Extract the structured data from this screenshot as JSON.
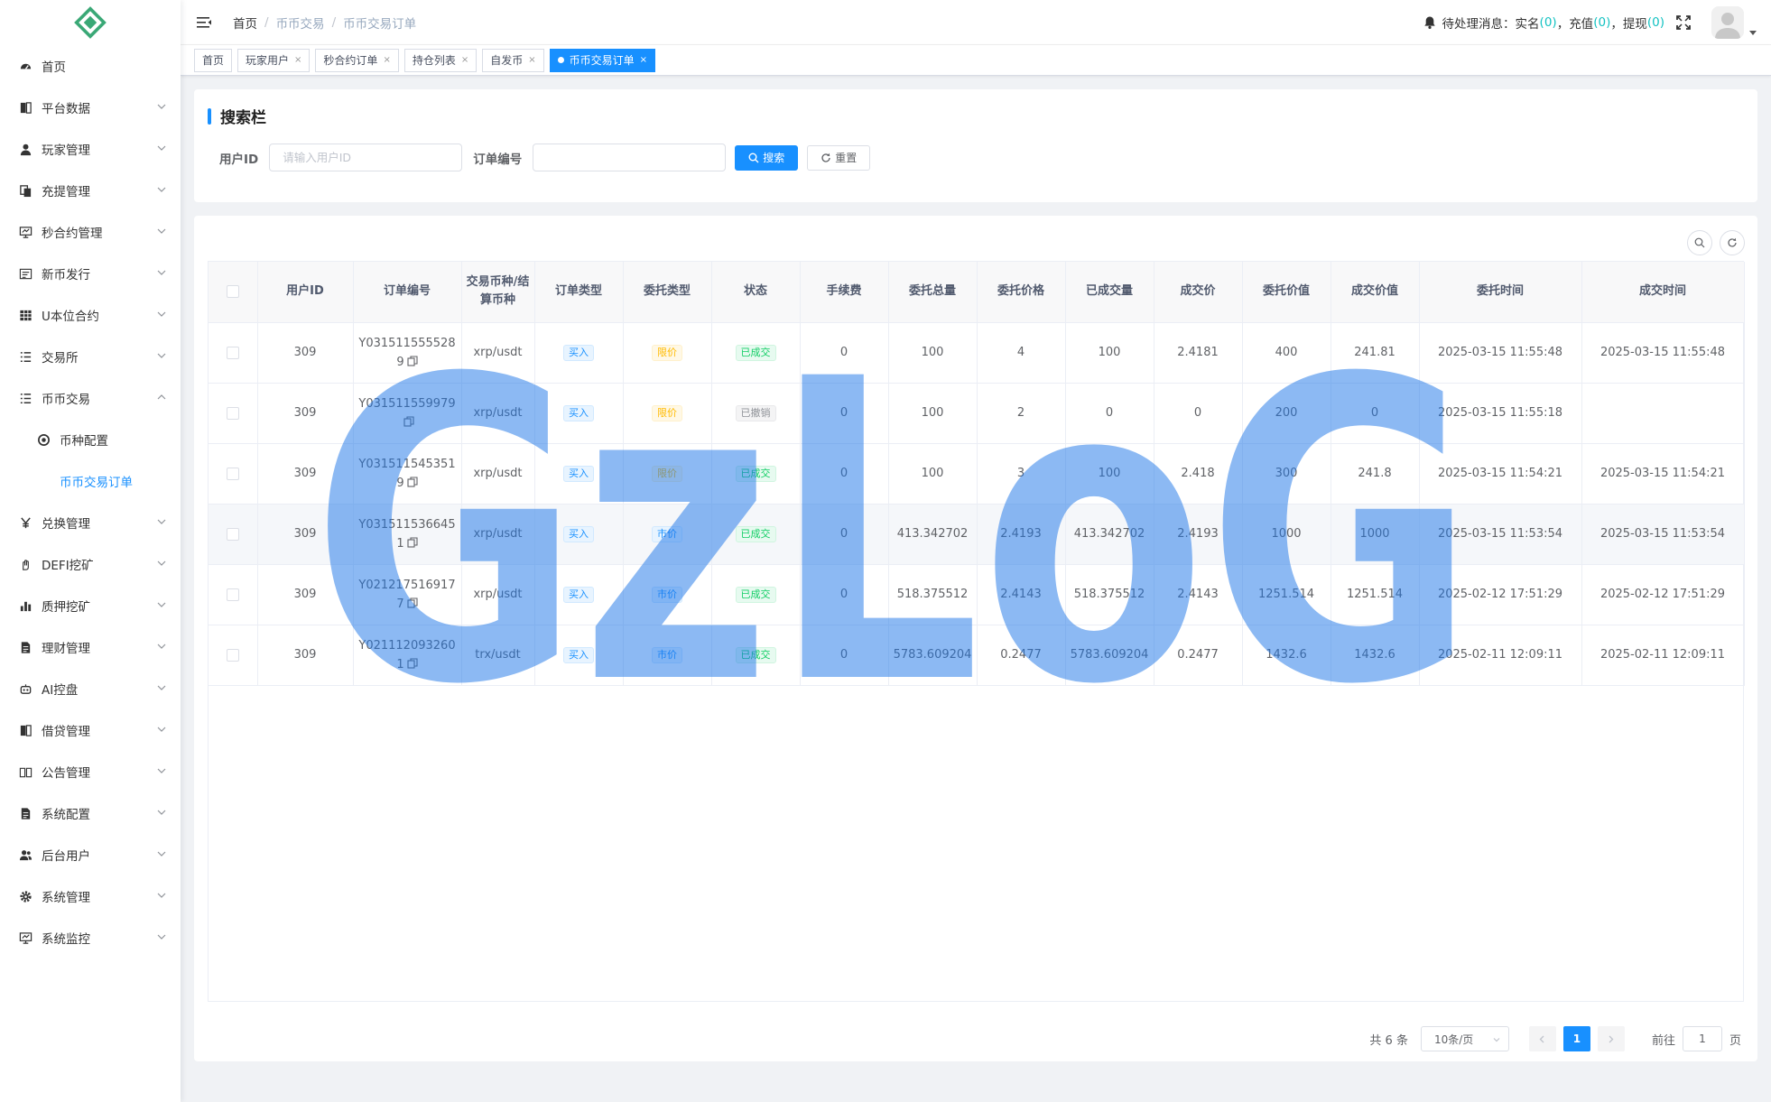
{
  "sidebar": {
    "items": [
      {
        "label": "首页",
        "icon": "dashboard-icon",
        "expandable": false
      },
      {
        "label": "平台数据",
        "icon": "book-icon",
        "expandable": true
      },
      {
        "label": "玩家管理",
        "icon": "user-icon",
        "expandable": true
      },
      {
        "label": "充提管理",
        "icon": "copy-icon",
        "expandable": true
      },
      {
        "label": "秒合约管理",
        "icon": "monitor-chart-icon",
        "expandable": true
      },
      {
        "label": "新币发行",
        "icon": "form-icon",
        "expandable": true
      },
      {
        "label": "U本位合约",
        "icon": "table-icon",
        "expandable": true
      },
      {
        "label": "交易所",
        "icon": "list-icon",
        "expandable": true
      },
      {
        "label": "币币交易",
        "icon": "list-icon",
        "expandable": true,
        "expanded": true
      },
      {
        "label": "币种配置",
        "icon": "coin-icon",
        "sub": true
      },
      {
        "label": "币币交易订单",
        "sub": true,
        "active": true
      },
      {
        "label": "兑换管理",
        "icon": "yen-icon",
        "expandable": true
      },
      {
        "label": "DEFI挖矿",
        "icon": "hand-icon",
        "expandable": true
      },
      {
        "label": "质押挖矿",
        "icon": "bar-chart-icon",
        "expandable": true
      },
      {
        "label": "理财管理",
        "icon": "document-icon",
        "expandable": true
      },
      {
        "label": "AI控盘",
        "icon": "robot-icon",
        "expandable": true
      },
      {
        "label": "借贷管理",
        "icon": "book-icon",
        "expandable": true
      },
      {
        "label": "公告管理",
        "icon": "open-book-icon",
        "expandable": true
      },
      {
        "label": "系统配置",
        "icon": "document-icon",
        "expandable": true
      },
      {
        "label": "后台用户",
        "icon": "users-icon",
        "expandable": true
      },
      {
        "label": "系统管理",
        "icon": "gear-icon",
        "expandable": true
      },
      {
        "label": "系统监控",
        "icon": "monitor-chart-icon",
        "expandable": true
      }
    ]
  },
  "header": {
    "breadcrumb": [
      "首页",
      "币币交易",
      "币币交易订单"
    ],
    "pending_label": "待处理消息：",
    "pending": [
      {
        "label": "实名",
        "count": "0"
      },
      {
        "label": "充值",
        "count": "0"
      },
      {
        "label": "提现",
        "count": "0"
      }
    ]
  },
  "tags": [
    {
      "label": "首页",
      "closable": false
    },
    {
      "label": "玩家用户",
      "closable": true
    },
    {
      "label": "秒合约订单",
      "closable": true
    },
    {
      "label": "持仓列表",
      "closable": true
    },
    {
      "label": "自发币",
      "closable": true
    },
    {
      "label": "币币交易订单",
      "closable": true,
      "active": true
    }
  ],
  "search": {
    "title": "搜索栏",
    "user_id_label": "用户ID",
    "user_id_placeholder": "请输入用户ID",
    "order_no_label": "订单编号",
    "order_no_value": "",
    "search_button": "搜索",
    "reset_button": "重置"
  },
  "table": {
    "columns": [
      "",
      "用户ID",
      "订单编号",
      "交易币种/结算币种",
      "订单类型",
      "委托类型",
      "状态",
      "手续费",
      "委托总量",
      "委托价格",
      "已成交量",
      "成交价",
      "委托价值",
      "成交价值",
      "委托时间",
      "成交时间"
    ],
    "rows": [
      {
        "user_id": "309",
        "order_no": "Y0315115555289",
        "pair": "xrp/usdt",
        "order_type": "买入",
        "entrust_type": "限价",
        "status": "已成交",
        "fee": "0",
        "total": "100",
        "price": "4",
        "filled": "100",
        "deal_price": "2.4181",
        "entrust_value": "400",
        "deal_value": "241.81",
        "entrust_time": "2025-03-15 11:55:48",
        "deal_time": "2025-03-15 11:55:48"
      },
      {
        "user_id": "309",
        "order_no": "Y031511559979",
        "pair": "xrp/usdt",
        "order_type": "买入",
        "entrust_type": "限价",
        "status": "已撤销",
        "fee": "0",
        "total": "100",
        "price": "2",
        "filled": "0",
        "deal_price": "0",
        "entrust_value": "200",
        "deal_value": "0",
        "entrust_time": "2025-03-15 11:55:18",
        "deal_time": ""
      },
      {
        "user_id": "309",
        "order_no": "Y0315115453519",
        "pair": "xrp/usdt",
        "order_type": "买入",
        "entrust_type": "限价",
        "status": "已成交",
        "fee": "0",
        "total": "100",
        "price": "3",
        "filled": "100",
        "deal_price": "2.418",
        "entrust_value": "300",
        "deal_value": "241.8",
        "entrust_time": "2025-03-15 11:54:21",
        "deal_time": "2025-03-15 11:54:21"
      },
      {
        "user_id": "309",
        "order_no": "Y0315115366451",
        "pair": "xrp/usdt",
        "order_type": "买入",
        "entrust_type": "市价",
        "status": "已成交",
        "fee": "0",
        "total": "413.342702",
        "price": "2.4193",
        "filled": "413.342702",
        "deal_price": "2.4193",
        "entrust_value": "1000",
        "deal_value": "1000",
        "entrust_time": "2025-03-15 11:53:54",
        "deal_time": "2025-03-15 11:53:54",
        "highlight": true
      },
      {
        "user_id": "309",
        "order_no": "Y0212175169177",
        "pair": "xrp/usdt",
        "order_type": "买入",
        "entrust_type": "市价",
        "status": "已成交",
        "fee": "0",
        "total": "518.375512",
        "price": "2.4143",
        "filled": "518.375512",
        "deal_price": "2.4143",
        "entrust_value": "1251.514",
        "deal_value": "1251.514",
        "entrust_time": "2025-02-12 17:51:29",
        "deal_time": "2025-02-12 17:51:29"
      },
      {
        "user_id": "309",
        "order_no": "Y0211120932601",
        "pair": "trx/usdt",
        "order_type": "买入",
        "entrust_type": "市价",
        "status": "已成交",
        "fee": "0",
        "total": "5783.609204",
        "price": "0.2477",
        "filled": "5783.609204",
        "deal_price": "0.2477",
        "entrust_value": "1432.6",
        "deal_value": "1432.6",
        "entrust_time": "2025-02-11 12:09:11",
        "deal_time": "2025-02-11 12:09:11"
      }
    ]
  },
  "pagination": {
    "total_text": "共 6 条",
    "page_size": "10条/页",
    "current_page": "1",
    "goto_label": "前往",
    "goto_value": "1",
    "page_suffix": "页"
  },
  "watermark": {
    "text": "GzLoG",
    "color": "#1a73e8"
  },
  "colors": {
    "primary": "#1890ff",
    "pending_count": "#13c2c2"
  }
}
